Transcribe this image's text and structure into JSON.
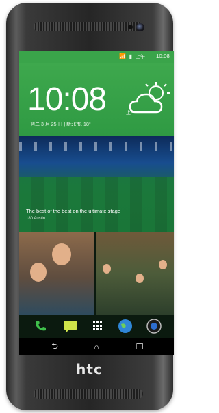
{
  "device": {
    "brand": "htc"
  },
  "status_bar": {
    "time": "10:08",
    "alarm": "上午",
    "icons": "wifi, signal, battery"
  },
  "weather_widget": {
    "clock": "10:08",
    "ampm": "上午",
    "date": "週二 3 月 25 日 | 新北市, 18°",
    "icon": "partly-cloudy-icon"
  },
  "feed": {
    "title": "The best of the best on the ultimate stage",
    "source": "180 Austin"
  },
  "dock": {
    "items": [
      "phone-icon",
      "messages-icon",
      "apps-icon",
      "browser-icon",
      "camera-icon"
    ]
  },
  "navbar": {
    "items": [
      "back-icon",
      "home-icon",
      "recent-apps-icon"
    ]
  },
  "colors": {
    "accent_green": "#3aa44a",
    "phone_body": "#2b2b2b"
  }
}
